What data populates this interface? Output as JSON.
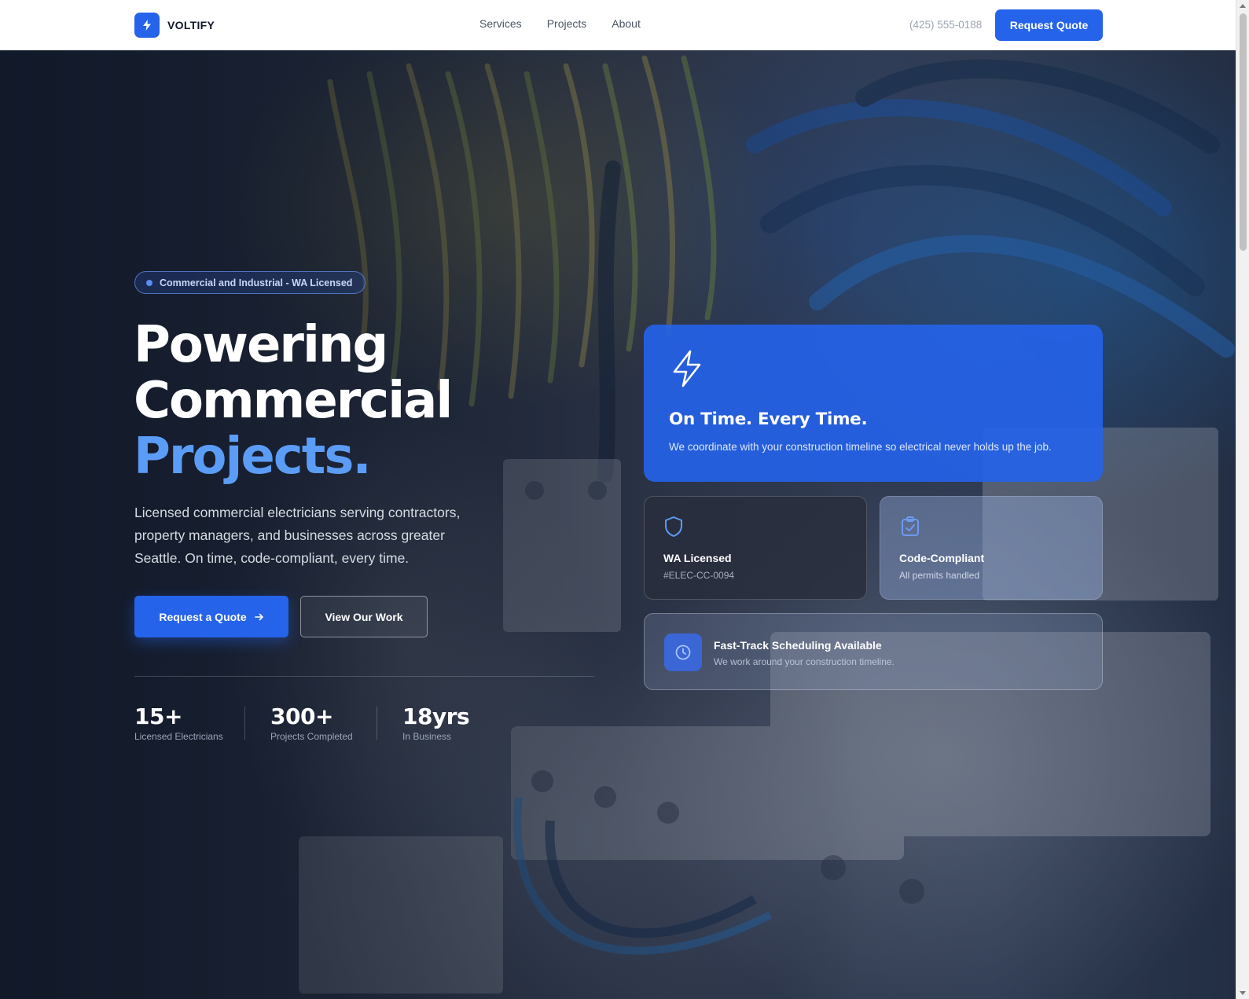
{
  "header": {
    "brand": "VOLTIFY",
    "nav": [
      "Services",
      "Projects",
      "About"
    ],
    "phone": "(425) 555-0188",
    "cta": "Request Quote"
  },
  "hero": {
    "badge": "Commercial and Industrial - WA Licensed",
    "headline_line1": "Powering",
    "headline_line2": "Commercial",
    "headline_accent": "Projects.",
    "lede": "Licensed commercial electricians serving contractors, property managers, and businesses across greater Seattle. On time, code-compliant, every time.",
    "primary_button": "Request a Quote",
    "secondary_button": "View Our Work",
    "stats": [
      {
        "value": "15+",
        "label": "Licensed Electricians"
      },
      {
        "value": "300+",
        "label": "Projects Completed"
      },
      {
        "value": "18yrs",
        "label": "In Business"
      }
    ]
  },
  "cards": {
    "main": {
      "icon": "lightning-bolt-icon",
      "title": "On Time. Every Time.",
      "description": "We coordinate with your construction timeline so electrical never holds up the job."
    },
    "licensed": {
      "icon": "shield-icon",
      "title": "WA Licensed",
      "subtitle": "#ELEC-CC-0094"
    },
    "compliant": {
      "icon": "clipboard-check-icon",
      "title": "Code-Compliant",
      "subtitle": "All permits handled"
    },
    "scheduling": {
      "icon": "clock-icon",
      "title": "Fast-Track Scheduling Available",
      "subtitle": "We work around your construction timeline."
    }
  },
  "colors": {
    "accent": "#2563eb",
    "accent_light": "#5b9cf6",
    "dark": "#111827"
  }
}
